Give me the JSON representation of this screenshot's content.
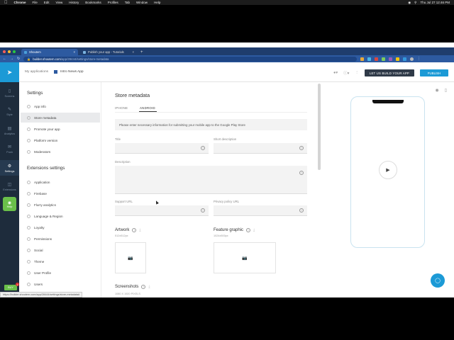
{
  "menubar": {
    "items": [
      "Chrome",
      "File",
      "Edit",
      "View",
      "History",
      "Bookmarks",
      "Profiles",
      "Tab",
      "Window",
      "Help"
    ],
    "clock": "Thu Jul 27  12:46 PM"
  },
  "browser": {
    "tabs": [
      {
        "label": "Shoutem",
        "active": true
      },
      {
        "label": "Publish your app - Tutorials",
        "active": false
      }
    ],
    "new_tab": "+",
    "url_host": "builder.shoutem.com",
    "url_path": "/app/28444/settings/store-metadata",
    "status_url": "https://builder.shoutem.com/app/28444/settings/store-metadata#"
  },
  "header": {
    "my_applications": "My applications",
    "app_name": "Intro News App",
    "build_button": "LET US BUILD YOUR APP",
    "publish_button": "PUBLISH"
  },
  "rail": {
    "items": [
      "Screens",
      "Style",
      "Analytics",
      "Push",
      "Settings",
      "Extensions"
    ],
    "active": "Settings",
    "help": "Help",
    "buy": "BUY",
    "buy_badge": "1"
  },
  "settings": {
    "title": "Settings",
    "items": [
      "App info",
      "Store metadata",
      "Promote your app",
      "Platform version",
      "Moderators"
    ],
    "active": "Store metadata",
    "ext_title": "Extensions settings",
    "ext_items": [
      "Application",
      "Firebase",
      "Flurry analytics",
      "Language & Region",
      "Loyalty",
      "Permissions",
      "Social",
      "Theme",
      "User Profile",
      "Users"
    ]
  },
  "form": {
    "title": "Store metadata",
    "tabs": [
      "IPHONE",
      "ANDROID"
    ],
    "active_tab": "ANDROID",
    "info": "Please enter necessary information for submitting your mobile app to the Google Play Store",
    "title_label": "Title",
    "short_desc_label": "Short description",
    "description_label": "Description",
    "support_url_label": "Support URL",
    "privacy_url_label": "Privacy policy URL",
    "artwork_label": "Artwork",
    "artwork_dims": "512x512px",
    "feature_label": "Feature graphic",
    "feature_dims": "1024x500px",
    "screenshots_label": "Screenshots",
    "screenshots_dims": "1080 X 1920 PIXELS"
  },
  "icons": {
    "info": "info-icon",
    "camera": "camera-icon",
    "download": "download-icon",
    "play": "play-icon",
    "chat": "chat-icon"
  },
  "colors": {
    "brand_blue": "#1c9ad6",
    "rail_bg": "#1e2c3c",
    "help_green": "#6ac04a",
    "build_btn": "#2f3a48"
  }
}
